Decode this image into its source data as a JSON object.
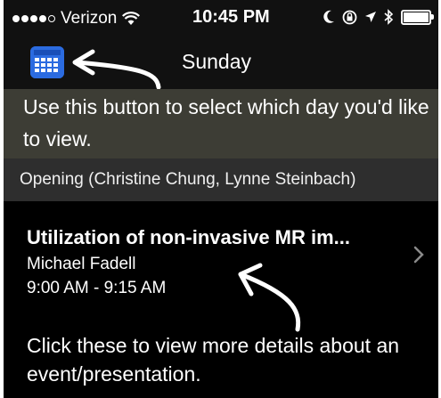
{
  "status_bar": {
    "carrier": "Verizon",
    "time": "10:45 PM"
  },
  "nav": {
    "title": "Sunday",
    "calendar_icon": "calendar-icon"
  },
  "instructions": {
    "select_day": "Use this button to select which day you'd like to view.",
    "event_details": "Click these to view more details about an event/presentation."
  },
  "section": {
    "header": "Opening (Christine Chung, Lynne Steinbach)"
  },
  "events": [
    {
      "title": "Utilization of non-invasive MR im...",
      "speaker": "Michael Fadell",
      "time": "9:00 AM - 9:15 AM"
    }
  ],
  "colors": {
    "accent": "#2b6be0",
    "banner_bg": "#3d3d35",
    "section_bg": "#2e2e2e"
  }
}
